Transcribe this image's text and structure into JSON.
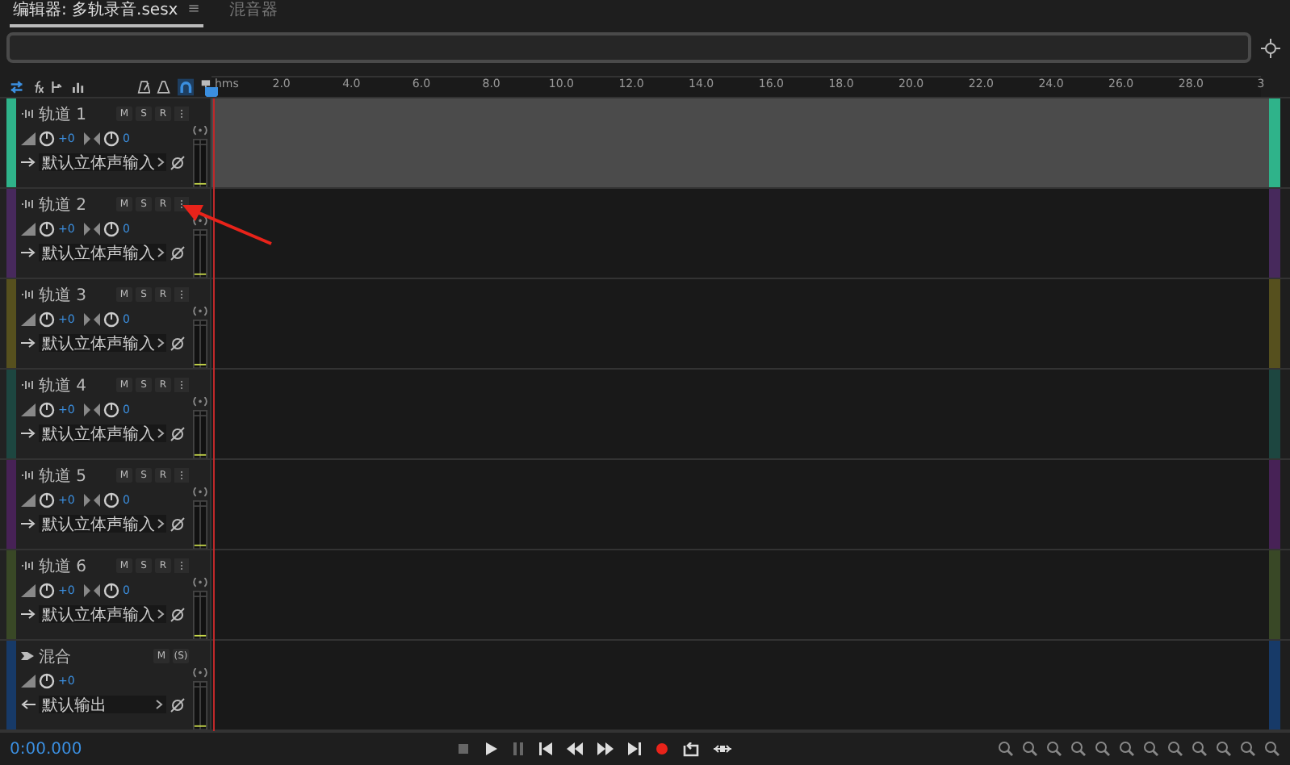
{
  "tabs": [
    {
      "label": "编辑器: 多轨录音.sesx",
      "selected": true,
      "menu": "≡"
    },
    {
      "label": "混音器",
      "selected": false
    }
  ],
  "ruler": {
    "unit": "hms",
    "ticks": [
      "2.0",
      "4.0",
      "6.0",
      "8.0",
      "10.0",
      "12.0",
      "14.0",
      "16.0",
      "18.0",
      "20.0",
      "22.0",
      "24.0",
      "26.0",
      "28.0",
      "3"
    ]
  },
  "tracks": [
    {
      "kind": "audio",
      "name": "轨道 1",
      "selected": true,
      "color": "#2fb38a",
      "buttons": [
        "M",
        "S",
        "R"
      ],
      "volume": "+0",
      "pan": "0",
      "route": "默认立体声输入"
    },
    {
      "kind": "audio",
      "name": "轨道 2",
      "selected": false,
      "color": "#47295c",
      "buttons": [
        "M",
        "S",
        "R"
      ],
      "volume": "+0",
      "pan": "0",
      "route": "默认立体声输入"
    },
    {
      "kind": "audio",
      "name": "轨道 3",
      "selected": false,
      "color": "#56501e",
      "buttons": [
        "M",
        "S",
        "R"
      ],
      "volume": "+0",
      "pan": "0",
      "route": "默认立体声输入"
    },
    {
      "kind": "audio",
      "name": "轨道 4",
      "selected": false,
      "color": "#1d4640",
      "buttons": [
        "M",
        "S",
        "R"
      ],
      "volume": "+0",
      "pan": "0",
      "route": "默认立体声输入"
    },
    {
      "kind": "audio",
      "name": "轨道 5",
      "selected": false,
      "color": "#472256",
      "buttons": [
        "M",
        "S",
        "R"
      ],
      "volume": "+0",
      "pan": "0",
      "route": "默认立体声输入"
    },
    {
      "kind": "audio",
      "name": "轨道 6",
      "selected": false,
      "color": "#394826",
      "buttons": [
        "M",
        "S",
        "R"
      ],
      "volume": "+0",
      "pan": "0",
      "route": "默认立体声输入"
    },
    {
      "kind": "mix",
      "name": "混合",
      "selected": false,
      "color": "#173a68",
      "buttons": [
        "M",
        "(S)"
      ],
      "volume": "+0",
      "route": "默认输出"
    }
  ],
  "time_display": "0:00.000"
}
